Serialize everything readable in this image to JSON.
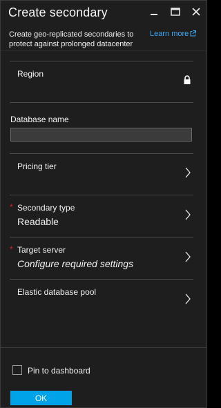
{
  "blade": {
    "title": "Create secondary",
    "description": "Create geo-replicated secondaries to protect against prolonged datacenter",
    "learn_more": "Learn more"
  },
  "fields": {
    "region": {
      "label": "Region",
      "locked": true
    },
    "database_name": {
      "label": "Database name",
      "value": "",
      "placeholder": ""
    },
    "pricing_tier": {
      "label": "Pricing tier"
    },
    "secondary_type": {
      "label": "Secondary type",
      "value": "Readable",
      "required": true
    },
    "target_server": {
      "label": "Target server",
      "value": "Configure required settings",
      "required": true
    },
    "elastic_pool": {
      "label": "Elastic database pool"
    }
  },
  "required_marker": "*",
  "footer": {
    "pin_label": "Pin to dashboard",
    "pin_checked": false,
    "ok_label": "OK"
  },
  "icons": {
    "minimize": "minimize-icon",
    "maximize": "maximize-icon",
    "close": "close-icon",
    "lock": "lock-icon",
    "chevron": "chevron-right-icon",
    "external": "external-link-icon"
  },
  "colors": {
    "background": "#1e1e1e",
    "accent": "#00a2e8",
    "link": "#3fa9f5",
    "required": "#e0202b"
  }
}
